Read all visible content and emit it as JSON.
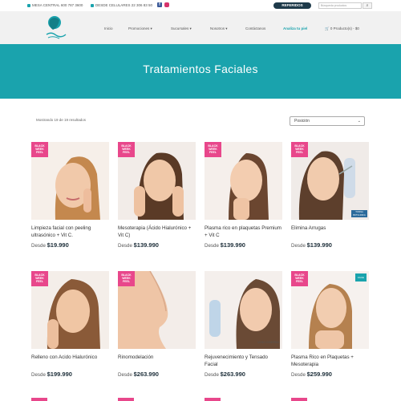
{
  "topbar": {
    "central_label": "MESA CENTRAL 600 787 3600",
    "mobile_label": "DESDE CELULARES 22 306 83 50",
    "facebook_glyph": "f",
    "referrals_label": "REFERIDOS",
    "search_placeholder": "Búsqueda productos",
    "search_button_glyph": "⌕"
  },
  "nav": {
    "items": [
      {
        "label": "Inicio"
      },
      {
        "label": "Promociones ▾"
      },
      {
        "label": "Sucursales ▾"
      },
      {
        "label": "Nosotros ▾"
      },
      {
        "label": "Contáctanos"
      },
      {
        "label": "Analiza tu piel"
      }
    ],
    "cart_label": "🛒 0 Producto(s) - $0"
  },
  "hero": {
    "title": "Tratamientos Faciales"
  },
  "results": {
    "text": "Mostrando 19 de 19 resultados"
  },
  "sort": {
    "selected": "Posición",
    "arrow": "⌄"
  },
  "badge": {
    "line1": "BLACK",
    "line2": "WEEK",
    "line3": "FEEL"
  },
  "products": [
    {
      "name": "Limpieza facial con peeling ultrasónico + Vit C.",
      "prefix": "Desde",
      "price": "$19.990"
    },
    {
      "name": "Mesoterapia (Ácido Hialurónico + Vit C)",
      "prefix": "Desde",
      "price": "$139.990"
    },
    {
      "name": "Plasma rico en plaquetas Premium + Vit C",
      "prefix": "Desde",
      "price": "$139.990"
    },
    {
      "name": "Elimina Arrugas",
      "prefix": "Desde",
      "price": "$139.990"
    },
    {
      "name": "Relleno con Acido Hialurónico",
      "prefix": "Desde",
      "price": "$199.990"
    },
    {
      "name": "Rinomodelación",
      "prefix": "Desde",
      "price": "$263.990"
    },
    {
      "name": "Rejuvenecimiento y Tensado Facial",
      "prefix": "Desde",
      "price": "$263.990"
    },
    {
      "name": "Plasma Rico en Plaquetas + Mesoterapia",
      "prefix": "Desde",
      "price": "$259.990"
    }
  ],
  "overlays": {
    "toxina": "TOXINA BOTULINICA",
    "viscoderm": "VISCODERM",
    "corner_tag": "FACE"
  },
  "colors": {
    "accent": "#1aa3ad",
    "badge": "#e8478b",
    "dark": "#1e3a4a"
  }
}
